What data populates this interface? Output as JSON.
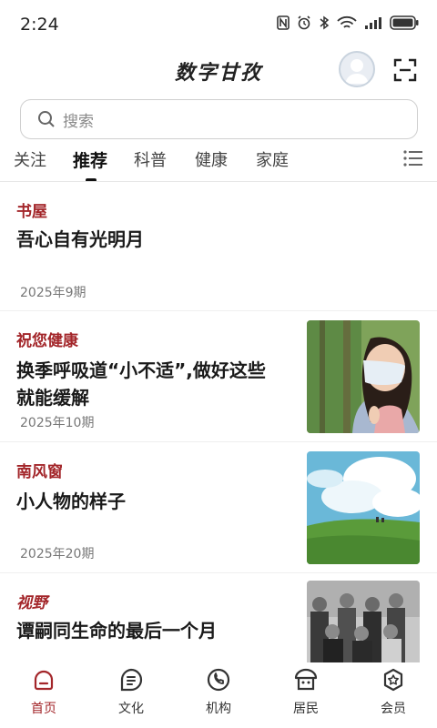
{
  "status_bar": {
    "time": "2:24"
  },
  "header": {
    "title": "数字甘孜"
  },
  "search": {
    "placeholder": "搜索"
  },
  "tabs": [
    {
      "label": "关注"
    },
    {
      "label": "推荐"
    },
    {
      "label": "科普"
    },
    {
      "label": "健康"
    },
    {
      "label": "家庭"
    }
  ],
  "active_tab": "推荐",
  "feed": [
    {
      "source": "书屋",
      "title": "吾心自有光明月",
      "date": "2025年9期"
    },
    {
      "source": "祝您健康",
      "title_line1": "换季呼吸道“小不适”,做好这些",
      "title_line2": "就能缓解",
      "date": "2025年10期"
    },
    {
      "source": "南风窗",
      "title": "小人物的样子",
      "date": "2025年20期"
    },
    {
      "source": "视野",
      "title": "谭嗣同生命的最后一个月"
    }
  ],
  "bottom_nav": [
    {
      "label": "首页",
      "icon": "home-icon"
    },
    {
      "label": "文化",
      "icon": "culture-icon"
    },
    {
      "label": "机构",
      "icon": "phone-icon"
    },
    {
      "label": "居民",
      "icon": "residents-icon"
    },
    {
      "label": "会员",
      "icon": "member-icon"
    }
  ],
  "active_nav": "首页",
  "colors": {
    "accent": "#a3262a",
    "text": "#1a1a1a",
    "muted": "#777777"
  }
}
